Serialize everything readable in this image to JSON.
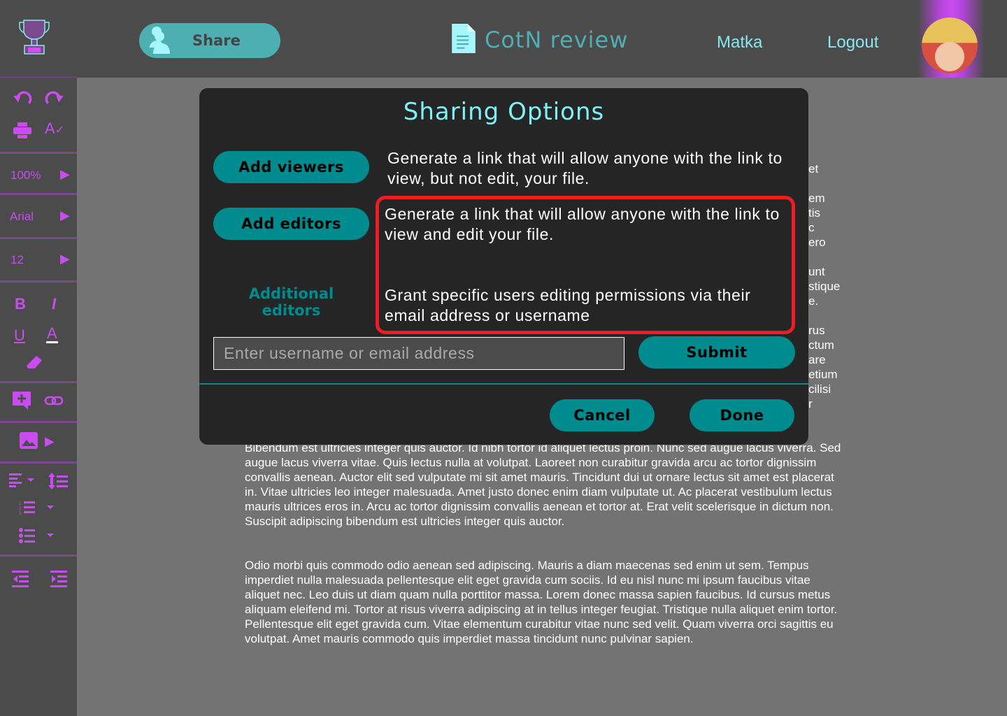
{
  "header": {
    "share_label": "Share",
    "doc_title": "CotN review",
    "user_name": "Matka",
    "logout_label": "Logout"
  },
  "sidebar": {
    "zoom": "100%",
    "font": "Arial",
    "font_size": "12",
    "bold": "B",
    "italic": "I",
    "underline": "U",
    "text_color": "A"
  },
  "document": {
    "hidden_fragments": "et\n\nem\ntis\nc\nero\n\nunt\nstique\ne.\n\nrus\nctum\nare\netium\ncilisi\nr",
    "paragraph_1": "Bibendum est ultricies integer quis auctor. Id nibh tortor id aliquet lectus proin. Nunc sed augue lacus viverra. Sed augue lacus viverra vitae. Quis lectus nulla at volutpat. Laoreet non curabitur gravida arcu ac tortor dignissim convallis aenean. Auctor elit sed vulputate mi sit amet mauris. Tincidunt dui ut ornare lectus sit amet est placerat in. Vitae ultricies leo integer malesuada. Amet justo donec enim diam vulputate ut. Ac placerat vestibulum lectus mauris ultrices eros in. Arcu ac tortor dignissim convallis aenean et tortor at. Erat velit scelerisque in dictum non. Suscipit adipiscing bibendum est ultricies integer quis auctor.",
    "paragraph_2": "Odio morbi quis commodo odio aenean sed adipiscing. Mauris a diam maecenas sed enim ut sem. Tempus imperdiet nulla malesuada pellentesque elit eget gravida cum sociis. Id eu nisl nunc mi ipsum faucibus vitae aliquet nec. Leo duis ut diam quam nulla porttitor massa. Lorem donec massa sapien faucibus. Id cursus metus aliquam eleifend mi. Tortor at risus viverra adipiscing at in tellus integer feugiat. Tristique nulla aliquet enim tortor. Pellentesque elit eget gravida cum. Vitae elementum curabitur vitae nunc sed velit. Quam viverra orci sagittis eu volutpat. Amet mauris commodo quis imperdiet massa tincidunt nunc pulvinar sapien."
  },
  "modal": {
    "title": "Sharing Options",
    "add_viewers_label": "Add viewers",
    "add_viewers_desc": "Generate a link that will allow anyone with the link to view, but not edit, your file.",
    "add_editors_label": "Add editors",
    "add_editors_desc": "Generate a link that will allow anyone with the link to view and edit your file.",
    "additional_editors_label": "Additional editors",
    "additional_editors_desc": "Grant specific users editing permissions via their email address or username",
    "input_placeholder": "Enter username or email address",
    "submit_label": "Submit",
    "cancel_label": "Cancel",
    "done_label": "Done"
  },
  "colors": {
    "accent": "#008b8f",
    "header_text": "#8ae6ee",
    "toolbar": "#c94cf0",
    "highlight": "#ee1c25"
  }
}
